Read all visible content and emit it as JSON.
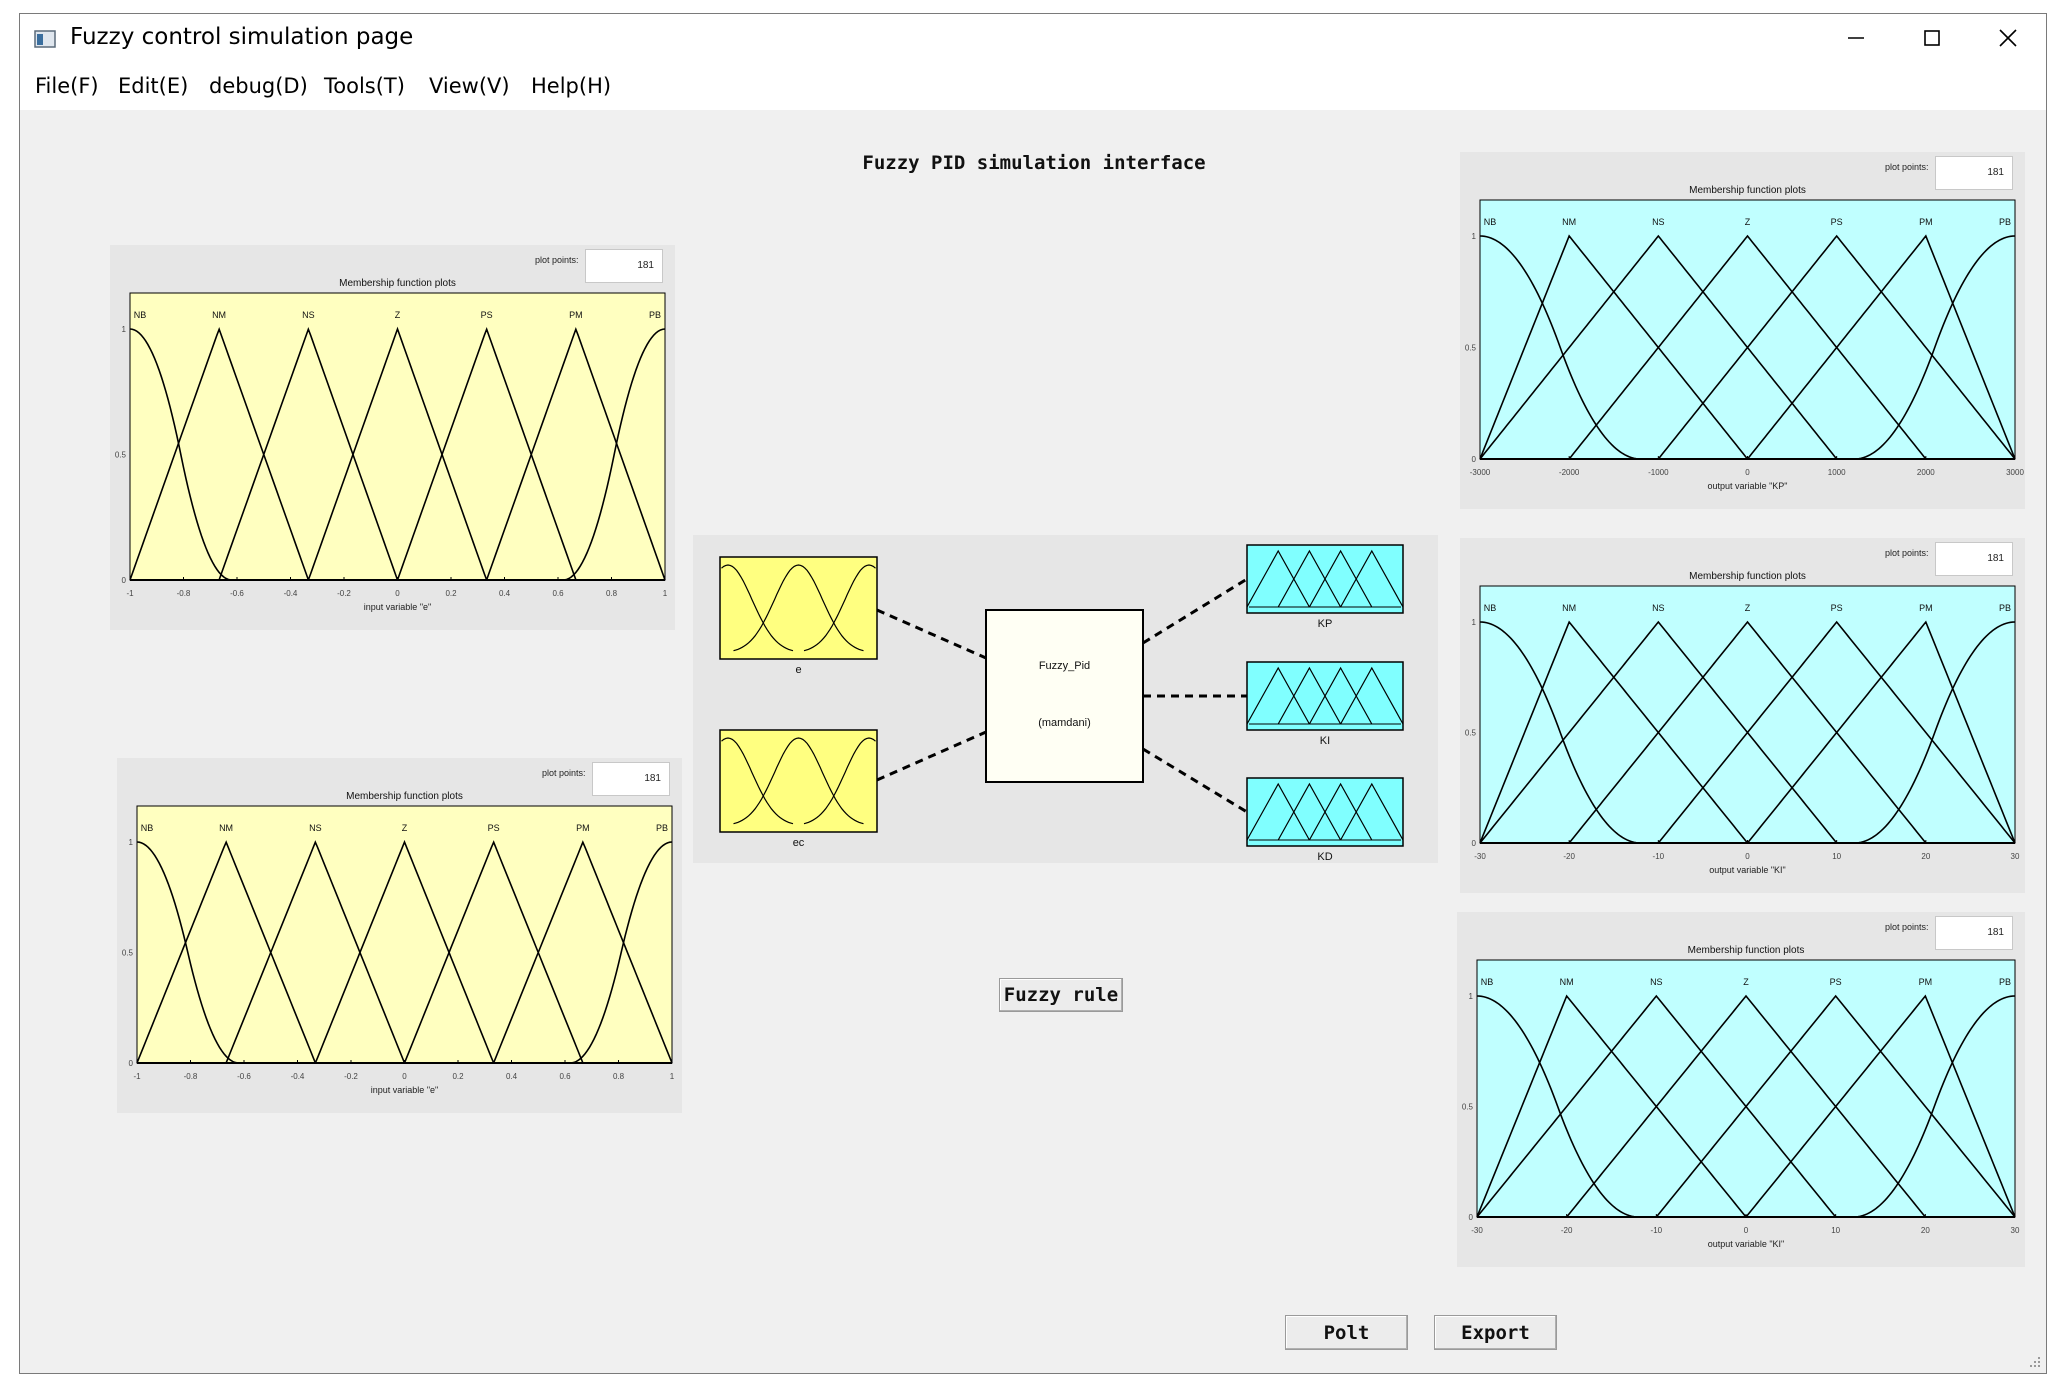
{
  "window": {
    "title": "Fuzzy control simulation page",
    "controls": [
      "minimize-icon",
      "maximize-icon",
      "close-icon"
    ]
  },
  "menu": [
    {
      "label": "File(F)"
    },
    {
      "label": "Edit(E)"
    },
    {
      "label": "debug(D)"
    },
    {
      "label": "Tools(T)"
    },
    {
      "label": "View(V)"
    },
    {
      "label": "Help(H)"
    }
  ],
  "main": {
    "title": "Fuzzy PID simulation interface"
  },
  "buttons": {
    "fuzzy_rule": "Fuzzy rule",
    "plot": "Polt",
    "export": "Export"
  },
  "fis_diagram": {
    "inputs": [
      {
        "label": "e",
        "color": "#ffff80"
      },
      {
        "label": "ec",
        "color": "#ffff80"
      }
    ],
    "system": {
      "name": "Fuzzy_Pid",
      "type": "(mamdani)"
    },
    "outputs": [
      {
        "label": "KP",
        "color": "#80ffff"
      },
      {
        "label": "KI",
        "color": "#80ffff"
      },
      {
        "label": "KD",
        "color": "#80ffff"
      }
    ]
  },
  "plot_points_label": "plot points:",
  "chart_data": [
    {
      "id": "mf-e-1",
      "type": "line",
      "title": "Membership function plots",
      "xlabel": "input variable \"e\"",
      "background": "#ffffc0",
      "plot_points": "181",
      "xlim": [
        -1,
        1
      ],
      "ylim": [
        0,
        1
      ],
      "xticks": [
        "-1",
        "-0.8",
        "-0.6",
        "-0.4",
        "-0.2",
        "0",
        "0.2",
        "0.4",
        "0.6",
        "0.8",
        "1"
      ],
      "yticks": [
        "0",
        "0.5",
        "1"
      ],
      "mf_names": [
        "NB",
        "NM",
        "NS",
        "Z",
        "PS",
        "PM",
        "PB"
      ],
      "mf_centers": [
        -1,
        -0.667,
        -0.333,
        0,
        0.333,
        0.667,
        1
      ],
      "series": [
        {
          "name": "NB",
          "shape": "zmf",
          "params": [
            -1,
            -0.62
          ]
        },
        {
          "name": "NM",
          "shape": "trimf",
          "params": [
            -1,
            -0.667,
            -0.333
          ]
        },
        {
          "name": "NS",
          "shape": "trimf",
          "params": [
            -0.667,
            -0.333,
            0
          ]
        },
        {
          "name": "Z",
          "shape": "trimf",
          "params": [
            -0.333,
            0,
            0.333
          ]
        },
        {
          "name": "PS",
          "shape": "trimf",
          "params": [
            0,
            0.333,
            0.667
          ]
        },
        {
          "name": "PM",
          "shape": "trimf",
          "params": [
            0.333,
            0.667,
            1
          ]
        },
        {
          "name": "PB",
          "shape": "smf",
          "params": [
            0.62,
            1
          ]
        }
      ]
    },
    {
      "id": "mf-e-2",
      "type": "line",
      "title": "Membership function plots",
      "xlabel": "input variable \"e\"",
      "background": "#ffffc0",
      "plot_points": "181",
      "xlim": [
        -1,
        1
      ],
      "ylim": [
        0,
        1
      ],
      "xticks": [
        "-1",
        "-0.8",
        "-0.6",
        "-0.4",
        "-0.2",
        "0",
        "0.2",
        "0.4",
        "0.6",
        "0.8",
        "1"
      ],
      "yticks": [
        "0",
        "0.5",
        "1"
      ],
      "mf_names": [
        "NB",
        "NM",
        "NS",
        "Z",
        "PS",
        "PM",
        "PB"
      ],
      "mf_centers": [
        -1,
        -0.667,
        -0.333,
        0,
        0.333,
        0.667,
        1
      ],
      "series": [
        {
          "name": "NB",
          "shape": "zmf",
          "params": [
            -1,
            -0.62
          ]
        },
        {
          "name": "NM",
          "shape": "trimf",
          "params": [
            -1,
            -0.667,
            -0.333
          ]
        },
        {
          "name": "NS",
          "shape": "trimf",
          "params": [
            -0.667,
            -0.333,
            0
          ]
        },
        {
          "name": "Z",
          "shape": "trimf",
          "params": [
            -0.333,
            0,
            0.333
          ]
        },
        {
          "name": "PS",
          "shape": "trimf",
          "params": [
            0,
            0.333,
            0.667
          ]
        },
        {
          "name": "PM",
          "shape": "trimf",
          "params": [
            0.333,
            0.667,
            1
          ]
        },
        {
          "name": "PB",
          "shape": "smf",
          "params": [
            0.62,
            1
          ]
        }
      ]
    },
    {
      "id": "mf-kp",
      "type": "line",
      "title": "Membership function plots",
      "xlabel": "output variable \"KP\"",
      "background": "#c0ffff",
      "plot_points": "181",
      "xlim": [
        -3000,
        3000
      ],
      "ylim": [
        0,
        1
      ],
      "xticks": [
        "-3000",
        "-2000",
        "-1000",
        "0",
        "1000",
        "2000",
        "3000"
      ],
      "yticks": [
        "0",
        "0.5",
        "1"
      ],
      "mf_names": [
        "NB",
        "NM",
        "NS",
        "Z",
        "PS",
        "PM",
        "PB"
      ],
      "mf_centers": [
        -3000,
        -2000,
        -1000,
        0,
        1000,
        2000,
        3000
      ],
      "series": [
        {
          "name": "NB",
          "shape": "zmf",
          "params": [
            -3000,
            -1200
          ]
        },
        {
          "name": "NM",
          "shape": "trimf",
          "params": [
            -3000,
            -2000,
            0
          ]
        },
        {
          "name": "NS",
          "shape": "trimf",
          "params": [
            -3000,
            -1000,
            1000
          ]
        },
        {
          "name": "Z",
          "shape": "trimf",
          "params": [
            -2000,
            0,
            2000
          ]
        },
        {
          "name": "PS",
          "shape": "trimf",
          "params": [
            -1000,
            1000,
            3000
          ]
        },
        {
          "name": "PM",
          "shape": "trimf",
          "params": [
            0,
            2000,
            3000
          ]
        },
        {
          "name": "PB",
          "shape": "smf",
          "params": [
            1200,
            3000
          ]
        }
      ]
    },
    {
      "id": "mf-ki",
      "type": "line",
      "title": "Membership function plots",
      "xlabel": "output variable \"KI\"",
      "background": "#c0ffff",
      "plot_points": "181",
      "xlim": [
        -30,
        30
      ],
      "ylim": [
        0,
        1
      ],
      "xticks": [
        "-30",
        "-20",
        "-10",
        "0",
        "10",
        "20",
        "30"
      ],
      "yticks": [
        "0",
        "0.5",
        "1"
      ],
      "mf_names": [
        "NB",
        "NM",
        "NS",
        "Z",
        "PS",
        "PM",
        "PB"
      ],
      "mf_centers": [
        -30,
        -20,
        -10,
        0,
        10,
        20,
        30
      ],
      "series": [
        {
          "name": "NB",
          "shape": "zmf",
          "params": [
            -30,
            -12
          ]
        },
        {
          "name": "NM",
          "shape": "trimf",
          "params": [
            -30,
            -20,
            0
          ]
        },
        {
          "name": "NS",
          "shape": "trimf",
          "params": [
            -30,
            -10,
            10
          ]
        },
        {
          "name": "Z",
          "shape": "trimf",
          "params": [
            -20,
            0,
            20
          ]
        },
        {
          "name": "PS",
          "shape": "trimf",
          "params": [
            -10,
            10,
            30
          ]
        },
        {
          "name": "PM",
          "shape": "trimf",
          "params": [
            0,
            20,
            30
          ]
        },
        {
          "name": "PB",
          "shape": "smf",
          "params": [
            12,
            30
          ]
        }
      ]
    },
    {
      "id": "mf-kd",
      "type": "line",
      "title": "Membership function plots",
      "xlabel": "output variable \"KI\"",
      "background": "#c0ffff",
      "plot_points": "181",
      "xlim": [
        -30,
        30
      ],
      "ylim": [
        0,
        1
      ],
      "xticks": [
        "-30",
        "-20",
        "-10",
        "0",
        "10",
        "20",
        "30"
      ],
      "yticks": [
        "0",
        "0.5",
        "1"
      ],
      "mf_names": [
        "NB",
        "NM",
        "NS",
        "Z",
        "PS",
        "PM",
        "PB"
      ],
      "mf_centers": [
        -30,
        -20,
        -10,
        0,
        10,
        20,
        30
      ],
      "series": [
        {
          "name": "NB",
          "shape": "zmf",
          "params": [
            -30,
            -12
          ]
        },
        {
          "name": "NM",
          "shape": "trimf",
          "params": [
            -30,
            -20,
            0
          ]
        },
        {
          "name": "NS",
          "shape": "trimf",
          "params": [
            -30,
            -10,
            10
          ]
        },
        {
          "name": "Z",
          "shape": "trimf",
          "params": [
            -20,
            0,
            20
          ]
        },
        {
          "name": "PS",
          "shape": "trimf",
          "params": [
            -10,
            10,
            30
          ]
        },
        {
          "name": "PM",
          "shape": "trimf",
          "params": [
            0,
            20,
            30
          ]
        },
        {
          "name": "PB",
          "shape": "smf",
          "params": [
            12,
            30
          ]
        }
      ]
    }
  ]
}
